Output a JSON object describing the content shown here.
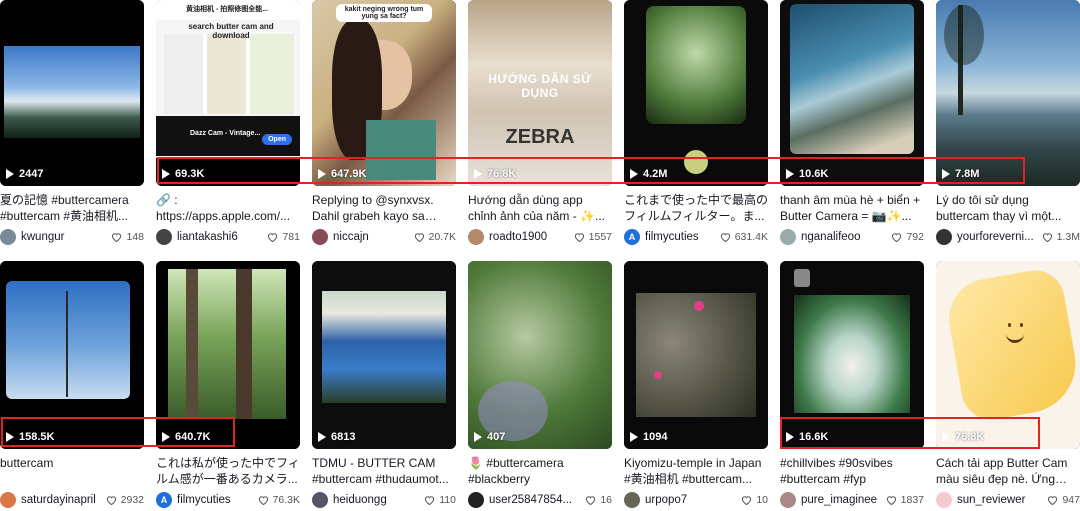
{
  "row1": [
    {
      "views": "2447",
      "caption": "夏の記憶 #buttercamera #buttercam #黄油相机...",
      "username": "kwungur",
      "likes": "148",
      "avatar": "#7a8a99",
      "thumb": "sky"
    },
    {
      "views": "69.3K",
      "caption": "🔗 :\nhttps://apps.apple.com/...",
      "username": "liantakashi6",
      "likes": "781",
      "avatar": "#444",
      "thumb": "appstore"
    },
    {
      "views": "647.9K",
      "caption": "Replying to @synxvsx. Dahil grabeh kayo sa last...",
      "username": "niccajn",
      "likes": "20.7K",
      "avatar": "#8a4a5a",
      "thumb": "girl"
    },
    {
      "views": "76.8K",
      "caption": "Hướng dẫn dùng app chỉnh ảnh của năm - ✨...",
      "username": "roadto1900",
      "likes": "1557",
      "avatar": "#b08a6a",
      "thumb": "coffee"
    },
    {
      "views": "4.2M",
      "caption": "これまで使った中で最高のフィルムフィルター。ま...",
      "username": "filmycuties",
      "likes": "631.4K",
      "avatar": "#1e6fd9",
      "thumb": "blur"
    },
    {
      "views": "10.6K",
      "caption": "thanh âm mùa hè + biển + Butter Camera = 📷✨...",
      "username": "nganalifeoo",
      "likes": "792",
      "avatar": "#9aa",
      "thumb": "sea"
    },
    {
      "views": "7.8M",
      "caption": "Lý do tôi sử dụng buttercam thay vì một...",
      "username": "yourforeverni...",
      "likes": "1.3M",
      "avatar": "#333",
      "thumb": "lake"
    }
  ],
  "row2": [
    {
      "views": "158.5K",
      "caption": "buttercam",
      "username": "saturdayinapril",
      "likes": "2932",
      "avatar": "#d9774a",
      "thumb": "tree"
    },
    {
      "views": "640.7K",
      "caption": "これは私が使った中でフィルム感が一番あるカメラ...",
      "username": "filmycuties",
      "likes": "76.3K",
      "avatar": "#1e6fd9",
      "thumb": "forest"
    },
    {
      "views": "6813",
      "caption": "TDMU - BUTTER CAM #buttercam #thudaumot...",
      "username": "heiduongg",
      "likes": "110",
      "avatar": "#556",
      "thumb": "building"
    },
    {
      "views": "407",
      "caption": "🌷 #buttercamera #blackberry",
      "username": "user25847854...",
      "likes": "16",
      "avatar": "#222",
      "thumb": "ivy"
    },
    {
      "views": "1094",
      "caption": "Kiyomizu-temple in Japan #黄油相机 #buttercam...",
      "username": "urpopo7",
      "likes": "10",
      "avatar": "#665",
      "thumb": "stones"
    },
    {
      "views": "16.6K",
      "caption": "#chillvibes #90svibes #buttercam #fyp",
      "username": "pure_imaginee",
      "likes": "1837",
      "avatar": "#a88",
      "thumb": "fountain"
    },
    {
      "views": "76.8K",
      "caption": "Cách tải app Butter Cam màu siêu đẹp nè. Ứng hộ...",
      "username": "sun_reviewer",
      "likes": "947",
      "avatar": "#f4c9d0",
      "thumb": "butter"
    }
  ],
  "overlays": {
    "coffee_title": "HƯỚNG DẪN SỬ DỤNG",
    "coffee_brand": "ZEBRA",
    "app_search": "search butter cam and download",
    "app_name": "Dazz Cam - Vintage...",
    "app_open": "Open",
    "app_store_title": "黄油相机 - 拍照修图全能...",
    "girl_bubble": "kakit neging wrong tum yung sa fact?"
  },
  "highlight_color": "#e02424"
}
